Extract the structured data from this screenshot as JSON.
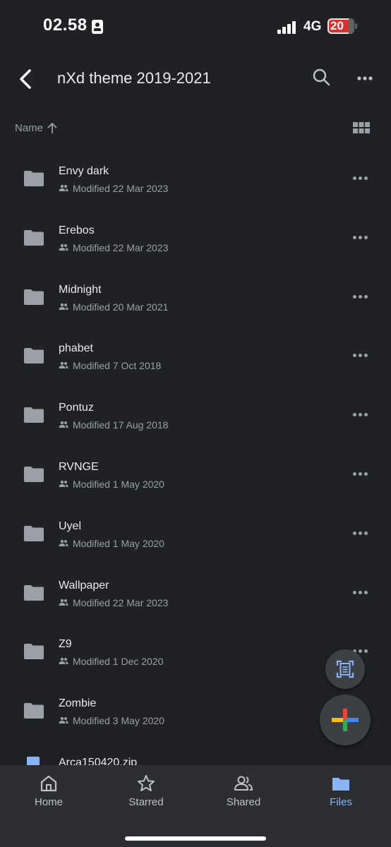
{
  "status_bar": {
    "time": "02.58",
    "network": "4G",
    "battery": "20"
  },
  "header": {
    "title": "nXd theme 2019-2021",
    "back_icon": "chevron-left-icon",
    "search_icon": "search-icon",
    "more_icon": "more-horizontal-icon"
  },
  "sort": {
    "label": "Name",
    "direction_icon": "arrow-up-icon",
    "view_icon": "grid-view-icon"
  },
  "files": [
    {
      "name": "Envy dark",
      "modified": "Modified 22 Mar 2023"
    },
    {
      "name": "Erebos",
      "modified": "Modified 22 Mar 2023"
    },
    {
      "name": "Midnight",
      "modified": "Modified 20 Mar 2021"
    },
    {
      "name": "phabet",
      "modified": "Modified 7 Oct 2018"
    },
    {
      "name": "Pontuz",
      "modified": "Modified 17 Aug 2018"
    },
    {
      "name": "RVNGE",
      "modified": "Modified 1 May 2020"
    },
    {
      "name": "Uyel",
      "modified": "Modified 1 May 2020"
    },
    {
      "name": "Wallpaper",
      "modified": "Modified 22 Mar 2023"
    },
    {
      "name": "Z9",
      "modified": "Modified 1 Dec 2020"
    },
    {
      "name": "Zombie",
      "modified": "Modified 3 May 2020"
    }
  ],
  "partial_file": {
    "name": "Arca150420.zip"
  },
  "bottom_nav": {
    "home": "Home",
    "starred": "Starred",
    "shared": "Shared",
    "files": "Files",
    "active": "Files"
  },
  "colors": {
    "background": "#202124",
    "accent": "#8ab4f8",
    "text_primary": "#e8eaed",
    "text_secondary": "#9aa0a6",
    "nav_background": "#2d2e31",
    "battery_low": "#d93030"
  }
}
